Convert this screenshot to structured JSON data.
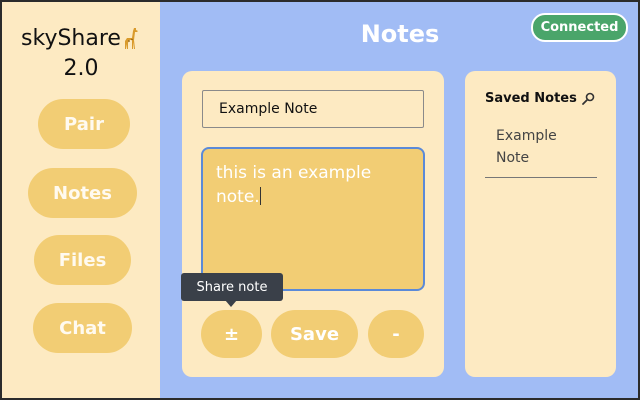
{
  "app": {
    "name": "skyShare",
    "version": "2.0"
  },
  "sidebar": {
    "items": [
      {
        "label": "Pair"
      },
      {
        "label": "Notes"
      },
      {
        "label": "Files"
      },
      {
        "label": "Chat"
      }
    ]
  },
  "header": {
    "title": "Notes",
    "status": "Connected"
  },
  "editor": {
    "title_value": "Example Note",
    "body_line1": "this is an example",
    "body_line2": "note.",
    "buttons": {
      "share": "±",
      "save": "Save",
      "delete": "-"
    },
    "tooltip": "Share note"
  },
  "saved_notes": {
    "heading": "Saved Notes",
    "items": [
      {
        "line1": "Example",
        "line2": "Note"
      }
    ]
  },
  "colors": {
    "background": "#a1bcf5",
    "panel": "#fdeac2",
    "accent": "#f2cd74",
    "status": "#4aa56a",
    "focus_border": "#5b8ad8"
  },
  "icons": {
    "logo": "giraffe-icon",
    "search": "magnifier-icon"
  }
}
